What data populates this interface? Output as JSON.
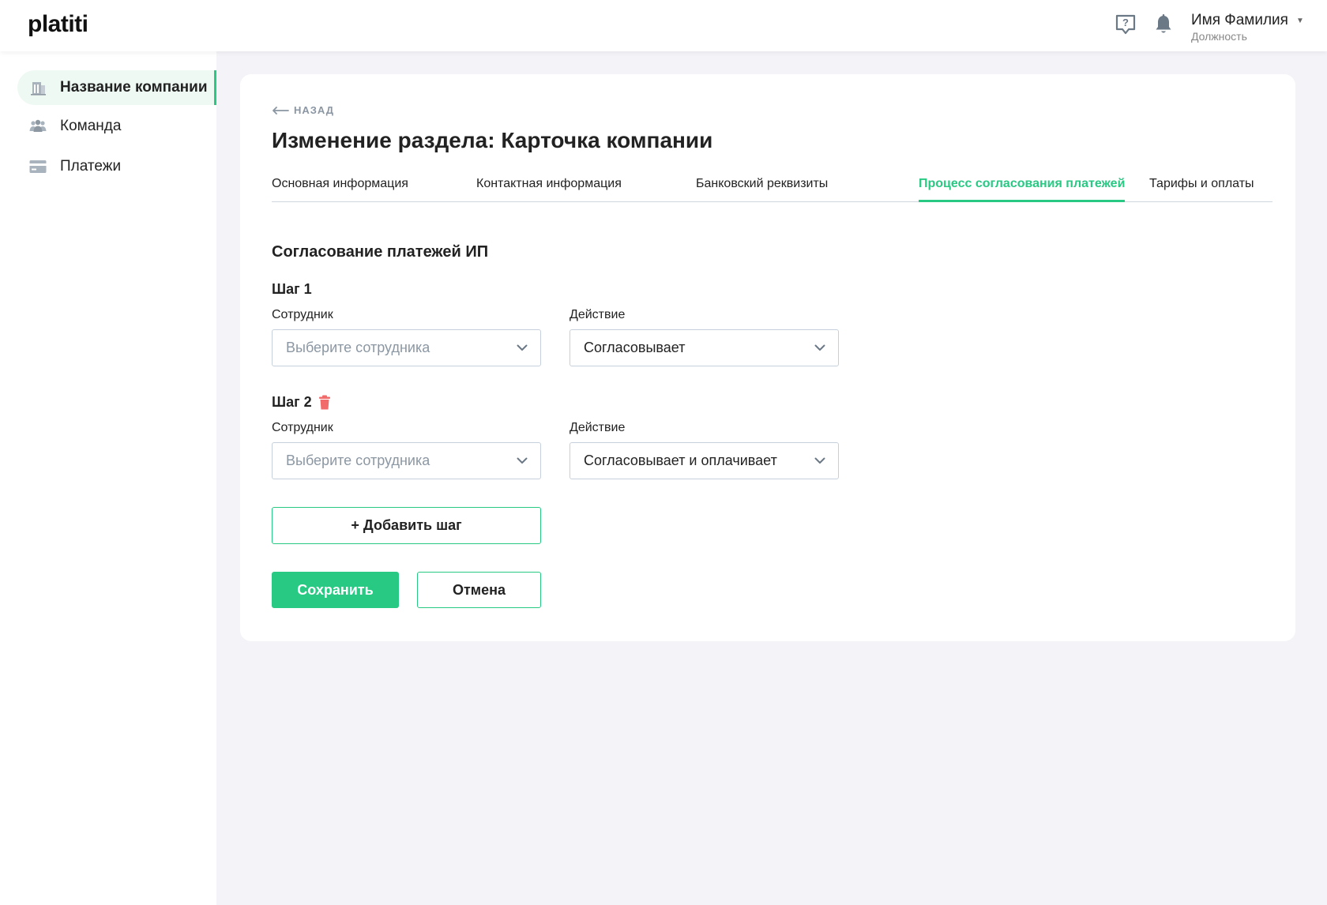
{
  "header": {
    "logo": "platiti",
    "user_name": "Имя Фамилия",
    "user_role": "Должность",
    "icons": [
      "help-chat-icon",
      "bell-icon",
      "caret-down-icon"
    ]
  },
  "sidebar": {
    "items": [
      {
        "label": "Название компании",
        "icon": "building-icon",
        "active": true
      },
      {
        "label": "Команда",
        "icon": "team-icon",
        "active": false
      },
      {
        "label": "Платежи",
        "icon": "card-icon",
        "active": false
      }
    ]
  },
  "main": {
    "back_label": "НАЗАД",
    "title": "Изменение раздела: Карточка компании",
    "tabs": [
      {
        "label": "Основная информация",
        "active": false
      },
      {
        "label": "Контактная информация",
        "active": false
      },
      {
        "label": "Банковский реквизиты",
        "active": false
      },
      {
        "label": "Процесс согласования платежей",
        "active": true
      },
      {
        "label": "Тарифы и оплаты",
        "active": false
      }
    ],
    "section_title": "Согласование платежей ИП",
    "steps": [
      {
        "title": "Шаг 1",
        "employee_label": "Сотрудник",
        "employee_placeholder": "Выберите сотрудника",
        "action_label": "Действие",
        "action_value": "Согласовывает",
        "deletable": false
      },
      {
        "title": "Шаг 2",
        "employee_label": "Сотрудник",
        "employee_placeholder": "Выберите сотрудника",
        "action_label": "Действие",
        "action_value": "Согласовывает и оплачивает",
        "deletable": true
      }
    ],
    "add_step_label": "+ Добавить шаг",
    "save_label": "Сохранить",
    "cancel_label": "Отмена"
  },
  "colors": {
    "accent": "#28c983",
    "danger": "#f26b6b",
    "muted": "#8a96a3",
    "background": "#f4f4f8"
  }
}
